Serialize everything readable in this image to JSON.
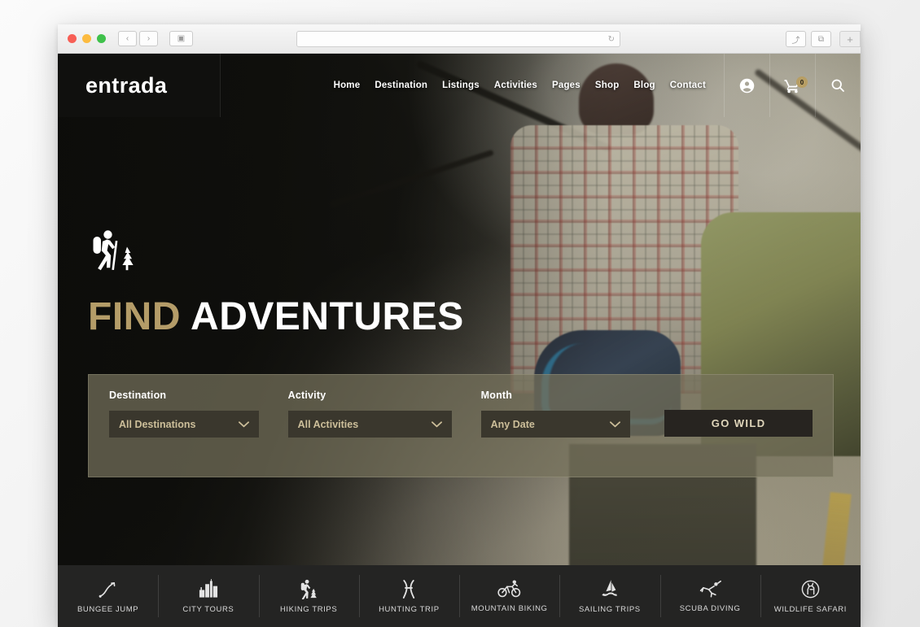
{
  "browser": {
    "traffic_lights": [
      "close",
      "minimize",
      "maximize"
    ],
    "back_label": "‹",
    "forward_label": "›",
    "sidebar_label": "▣",
    "address_value": "",
    "address_placeholder": "",
    "reload_label": "↻",
    "share_label": "⤴",
    "tabs_label": "⧉",
    "newtab_label": "+"
  },
  "header": {
    "logo": "entrada",
    "nav": [
      {
        "label": "Home"
      },
      {
        "label": "Destination"
      },
      {
        "label": "Listings"
      },
      {
        "label": "Activities"
      },
      {
        "label": "Pages"
      },
      {
        "label": "Shop"
      },
      {
        "label": "Blog"
      },
      {
        "label": "Contact"
      }
    ],
    "account_icon": "account-circle-icon",
    "cart_icon": "shopping-cart-icon",
    "cart_count": "0",
    "search_icon": "search-icon"
  },
  "hero": {
    "icon": "hiker-tree-icon",
    "title_accent": "FIND",
    "title_main": "ADVENTURES"
  },
  "search_form": {
    "fields": [
      {
        "label": "Destination",
        "value": "All Destinations",
        "name": "destination"
      },
      {
        "label": "Activity",
        "value": "All Activities",
        "name": "activity"
      },
      {
        "label": "Month",
        "value": "Any Date",
        "name": "month"
      }
    ],
    "submit_label": "GO WILD"
  },
  "activities": [
    {
      "label": "BUNGEE JUMP",
      "icon": "bungee-jump-icon"
    },
    {
      "label": "CITY TOURS",
      "icon": "city-tours-icon"
    },
    {
      "label": "HIKING TRIPS",
      "icon": "hiking-trips-icon"
    },
    {
      "label": "HUNTING TRIP",
      "icon": "hunting-trip-icon"
    },
    {
      "label": "MOUNTAIN BIKING",
      "icon": "mountain-biking-icon"
    },
    {
      "label": "SAILING TRIPS",
      "icon": "sailing-trips-icon"
    },
    {
      "label": "SCUBA DIVING",
      "icon": "scuba-diving-icon"
    },
    {
      "label": "WILDLIFE SAFARI",
      "icon": "wildlife-safari-icon"
    }
  ],
  "colors": {
    "accent_gold": "#b49c68",
    "panel_olive": "#76725c",
    "select_dark": "#3a372d",
    "button_dark": "#272420",
    "bar_dark": "#242423"
  }
}
